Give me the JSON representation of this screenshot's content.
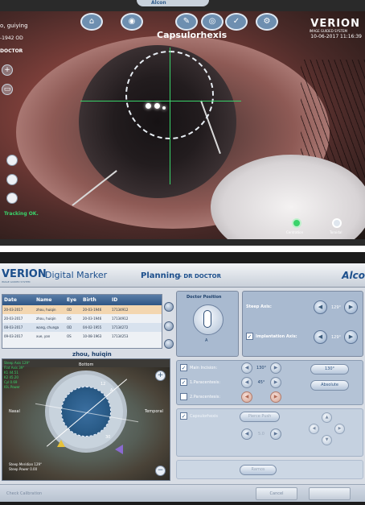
{
  "top_screen": {
    "patient_name": "o, guiying",
    "patient_id": "-1942  OD",
    "doctor": "DOCTOR",
    "step_title": "Capsulorhexis",
    "brand": "VERION",
    "brand_sub": "IMAGE GUIDED SYSTEM",
    "datetime": "10-06-2017 11:16:39",
    "tracking_status": "Tracking OK.",
    "tab_label": "Alcon",
    "bottom_buttons": [
      {
        "label": "Centration",
        "color": "#3ad36a"
      },
      {
        "label": "Toroidal",
        "color": "#dfe6ee"
      }
    ],
    "icons": [
      "home-icon",
      "camera-icon",
      "pen-icon",
      "eye-icon",
      "check-icon",
      "settings-icon"
    ]
  },
  "bottom_screen": {
    "brand": "VERION",
    "brand_sub": "IMAGE GUIDED SYSTEM",
    "app_name": "Digital Marker",
    "planning_label": "Planning",
    "doctor_label": "- DR DOCTOR",
    "alcon": "Alco",
    "table": {
      "headers": [
        "Date",
        "Name",
        "Eye",
        "Birth",
        "ID"
      ],
      "rows": [
        [
          "20-03-2017",
          "zhou, huiqin",
          "OD",
          "20-03-1946",
          "17134912"
        ],
        [
          "20-03-2017",
          "zhou, huiqin",
          "OS",
          "20-03-1946",
          "17134912"
        ],
        [
          "08-03-2017",
          "wang, chunga",
          "OD",
          "04-02-1955",
          "17134272"
        ],
        [
          "09-03-2017",
          "xue, yan",
          "OS",
          "10-08-1963",
          "17134253"
        ]
      ]
    },
    "eye_name": "zhou, huiqin",
    "eye_labels": {
      "bottom": "Bottom",
      "nasal": "Nasal",
      "temporal": "Temporal",
      "marker_a": "A",
      "marker_b": "12",
      "marker_c": "30"
    },
    "eye_notes_green": [
      "Steep Axis 129°",
      "Flat Axis 39°",
      "K1 44.51",
      "K2 45.20",
      "Cyl 0.69",
      "IOL Power"
    ],
    "eye_notes_bottom": [
      "Steep Meridian 129°",
      "Steep Power 0.00"
    ],
    "doctor_position": {
      "title": "Doctor Position",
      "letter": "A"
    },
    "axes": {
      "steep_label": "Steep Axis:",
      "steep_value": "129°",
      "implant_label": "Implantation Axis:",
      "implant_value": "129°"
    },
    "incisions": {
      "main_label": "Main Incision:",
      "main_value": "130°",
      "para1_label": "1.Paracentesis:",
      "para1_value": "45°",
      "para2_label": "2.Paracentesis:",
      "para2_value": "",
      "right_value": "130°",
      "absolute_label": "Absolute"
    },
    "capsulorhexis": {
      "label": "Capsulorhexis",
      "button": "Pierce Push",
      "value": "5.0"
    },
    "extra": {
      "button": "Ramos"
    },
    "footer": {
      "calibration": "Check Calibration",
      "btn_left": "Cancel",
      "btn_right": ""
    }
  }
}
